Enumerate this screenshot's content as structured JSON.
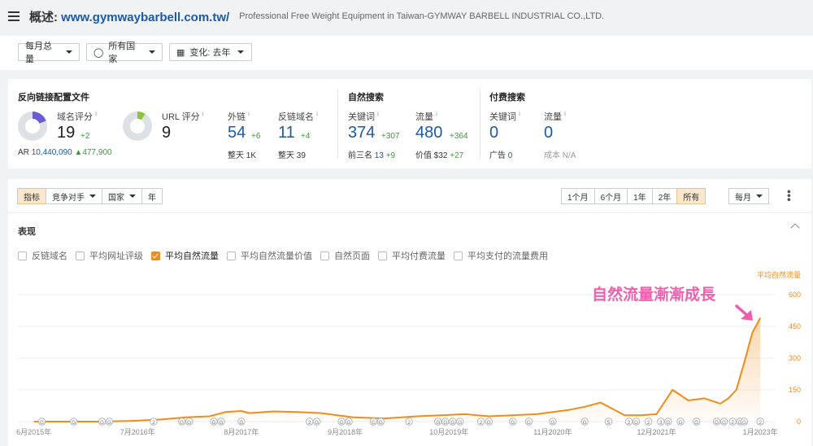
{
  "header": {
    "prefix": "概述: ",
    "domain": "www.gymwaybarbell.com.tw/",
    "subtitle": "Professional Free Weight Equipment in Taiwan-GYMWAY BARBELL INDUSTRIAL CO.,LTD."
  },
  "filters": {
    "monthly": "每月总量",
    "countries": "所有国家",
    "change": "变化: 去年"
  },
  "backlinks": {
    "title": "反向链接配置文件",
    "domain_score_label": "域名评分",
    "domain_score": "19",
    "domain_score_delta": "+2",
    "ar_label": "AR",
    "ar_value": "10,440,090",
    "ar_delta": "▲477,900",
    "url_score_label": "URL 评分",
    "url_score": "9",
    "ext_label": "外链",
    "ext_value": "54",
    "ext_delta": "+6",
    "ext_sub_label": "整天",
    "ext_sub_value": "1K",
    "ref_label": "反链域名",
    "ref_value": "11",
    "ref_delta": "+4",
    "ref_sub_label": "整天",
    "ref_sub_value": "39",
    "domain_donut_fraction": 0.19,
    "url_donut_fraction": 0.09,
    "domain_donut_color": "#6c5bd0",
    "url_donut_color": "#8bc540"
  },
  "organic": {
    "title": "自然搜索",
    "kw_label": "关键词",
    "kw_value": "374",
    "kw_delta": "+307",
    "kw_sub_label": "前三名",
    "kw_sub_value": "13",
    "kw_sub_delta": "+9",
    "traffic_label": "流量",
    "traffic_value": "480",
    "traffic_delta": "+364",
    "traffic_sub_label": "价值",
    "traffic_sub_value": "$32",
    "traffic_sub_delta": "+27"
  },
  "paid": {
    "title": "付费搜索",
    "kw_label": "关键词",
    "kw_value": "0",
    "kw_sub_label": "广告",
    "kw_sub_value": "0",
    "traffic_label": "流量",
    "traffic_value": "0",
    "traffic_sub_label": "成本",
    "traffic_sub_value": "N/A"
  },
  "toolbar": {
    "left_tabs": [
      "指标",
      "竞争对手",
      "国家",
      "年"
    ],
    "range_tabs": [
      "1个月",
      "6个月",
      "1年",
      "2年",
      "所有"
    ],
    "interval": "每月"
  },
  "section_title": "表现",
  "checkboxes": [
    {
      "label": "反链域名",
      "checked": false
    },
    {
      "label": "平均网址评级",
      "checked": false
    },
    {
      "label": "平均自然流量",
      "checked": true
    },
    {
      "label": "平均自然流量价值",
      "checked": false
    },
    {
      "label": "自然页面",
      "checked": false
    },
    {
      "label": "平均付费流量",
      "checked": false
    },
    {
      "label": "平均支付的流量费用",
      "checked": false
    }
  ],
  "colors": {
    "accent": "#f08c1a",
    "link": "#1a5aa8",
    "delta": "#3a9b3a",
    "annotation": "#ef5fae"
  },
  "chart_data": {
    "type": "area",
    "ylabel": "平均自然流量",
    "yticks": [
      0,
      150,
      300,
      450,
      600
    ],
    "ylim": [
      0,
      600
    ],
    "xlim": [
      "2015-04",
      "2023-02"
    ],
    "xticks": [
      "6月2015年",
      "7月2016年",
      "8月2017年",
      "9月2018年",
      "10月2019年",
      "11月2020年",
      "12月2021年",
      "1月2023年"
    ],
    "xtick_months": [
      "2015-06",
      "2016-07",
      "2017-08",
      "2018-09",
      "2019-10",
      "2020-11",
      "2021-12",
      "2023-01"
    ],
    "annotation": "自然流量漸漸成長",
    "series": [
      {
        "name": "平均自然流量",
        "x": [
          "2015-06",
          "2015-10",
          "2016-02",
          "2016-06",
          "2016-10",
          "2017-01",
          "2017-04",
          "2017-06",
          "2017-08",
          "2017-09",
          "2017-12",
          "2018-03",
          "2018-06",
          "2018-10",
          "2019-02",
          "2019-06",
          "2019-09",
          "2019-12",
          "2020-03",
          "2020-06",
          "2020-09",
          "2020-11",
          "2021-01",
          "2021-03",
          "2021-05",
          "2021-08",
          "2021-10",
          "2021-12",
          "2022-02",
          "2022-04",
          "2022-06",
          "2022-08",
          "2022-09",
          "2022-10",
          "2022-11",
          "2022-12",
          "2023-01"
        ],
        "y": [
          0,
          0,
          0,
          3,
          10,
          20,
          25,
          45,
          50,
          40,
          48,
          45,
          40,
          20,
          15,
          25,
          30,
          35,
          25,
          30,
          35,
          45,
          55,
          70,
          90,
          30,
          30,
          35,
          150,
          100,
          110,
          85,
          110,
          150,
          280,
          420,
          490
        ]
      }
    ],
    "markers": [
      "G",
      "G",
      "GG",
      "2",
      "GG",
      "GG",
      "G",
      "2G",
      "GG",
      "GG",
      "2",
      "GGGG",
      "2",
      "G",
      "G",
      "G",
      "G",
      "G",
      "5",
      "2G",
      "2",
      "3G",
      "G",
      "G",
      "GG",
      "2G",
      "G",
      "2"
    ],
    "marker_months": [
      "2015-07",
      "2015-11",
      "2016-03",
      "2016-09",
      "2017-01",
      "2017-05",
      "2017-08",
      "2018-05",
      "2018-09",
      "2019-01",
      "2019-05",
      "2019-10",
      "2020-02",
      "2020-03",
      "2020-06",
      "2020-08",
      "2020-11",
      "2021-03",
      "2021-06",
      "2021-09",
      "2021-11",
      "2022-01",
      "2022-03",
      "2022-05",
      "2022-08",
      "2022-10",
      "2022-11",
      "2023-01"
    ]
  }
}
